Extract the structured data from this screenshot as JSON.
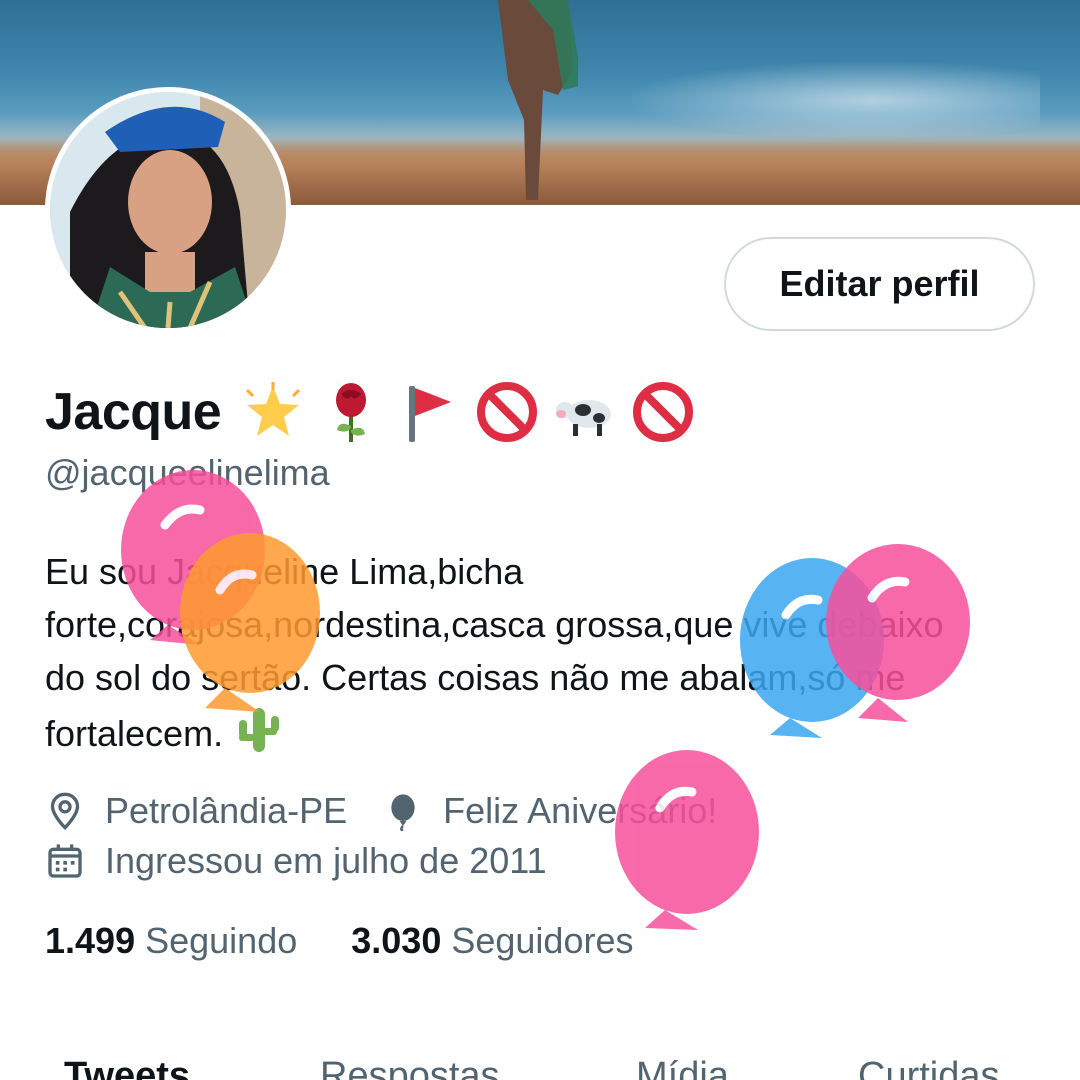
{
  "profile": {
    "name": "Jacque",
    "handle": "@jacqueelinelima",
    "bio": "Eu sou Jacqueline Lima,bicha forte,corajosa,nordestina,casca grossa,que vive debaixo do sol do sertão. Certas coisas não me abalam,só me fortalecem.",
    "name_emojis": [
      "glowing-star-icon",
      "rose-icon",
      "red-flag-icon",
      "no-entry-icon",
      "cow-icon",
      "no-entry-icon"
    ],
    "bio_emoji": "cactus-icon"
  },
  "actions": {
    "edit_label": "Editar perfil"
  },
  "meta": {
    "location": "Petrolândia-PE",
    "birthday": "Feliz Aniversário!",
    "joined": "Ingressou em julho de 2011"
  },
  "stats": {
    "following_count": "1.499",
    "following_label": "Seguindo",
    "followers_count": "3.030",
    "followers_label": "Seguidores"
  },
  "tabs": [
    "Tweets",
    "Respostas",
    "Mídia",
    "Curtidas"
  ],
  "colors": {
    "text": "#0f1419",
    "secondary": "#536471",
    "border": "#cfd9de",
    "balloon_pink": "#f7509b",
    "balloon_orange": "#ff9a2e",
    "balloon_blue": "#3ba6f0"
  }
}
